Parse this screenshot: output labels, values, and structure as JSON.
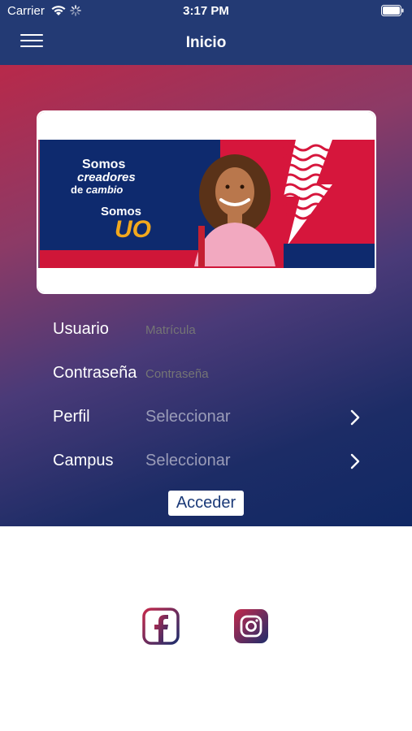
{
  "status_bar": {
    "carrier": "Carrier",
    "time": "3:17 PM",
    "icons": [
      "wifi-icon",
      "activity-spinner-icon",
      "battery-icon"
    ]
  },
  "nav": {
    "title": "Inicio",
    "menu_icon": "hamburger-menu-icon"
  },
  "banner": {
    "line1": "Somos",
    "line2": "creadores",
    "line3_a": "de",
    "line3_b": "cambio",
    "line4": "Somos",
    "line5": "UO"
  },
  "form": {
    "usuario_label": "Usuario",
    "usuario_placeholder": "Matrícula",
    "password_label": "Contraseña",
    "password_placeholder": "Contraseña",
    "perfil_label": "Perfil",
    "perfil_value": "Seleccionar",
    "campus_label": "Campus",
    "campus_value": "Seleccionar",
    "submit_label": "Acceder"
  },
  "social": {
    "icons": [
      "facebook-icon",
      "instagram-icon"
    ]
  },
  "colors": {
    "nav_bg": "#233a74",
    "gradient_top": "#b8294a",
    "gradient_bottom": "#102864",
    "accent_orange": "#f2a81d",
    "accent_red": "#d6163c"
  }
}
